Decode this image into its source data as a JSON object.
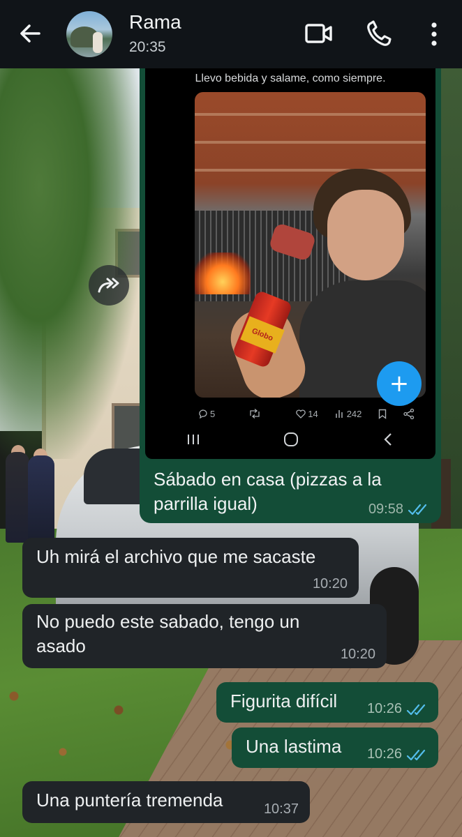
{
  "header": {
    "contact_name": "Rama",
    "last_seen": "20:35",
    "icons": [
      "back-arrow-icon",
      "video-call-icon",
      "phone-icon",
      "more-options-icon"
    ]
  },
  "image_message": {
    "tweet_text": "Llevo bebida y salame, como siempre.",
    "can_text": "Globo",
    "stats": {
      "replies": "5",
      "likes": "14",
      "views": "242"
    },
    "caption": "Sábado en casa (pizzas a la parrilla igual)",
    "time": "09:58",
    "status": "read"
  },
  "messages": [
    {
      "direction": "in",
      "text": "Uh mirá el archivo que me sacaste",
      "time": "10:20"
    },
    {
      "direction": "in",
      "text": "No puedo este sabado, tengo un asado",
      "time": "10:20"
    },
    {
      "direction": "out",
      "text": "Figurita difícil",
      "time": "10:26",
      "status": "read"
    },
    {
      "direction": "out",
      "text": "Una lastima",
      "time": "10:26",
      "status": "read"
    },
    {
      "direction": "in",
      "text": "Una puntería tremenda",
      "time": "10:37"
    }
  ],
  "colors": {
    "header_bg": "#101418",
    "outgoing_bubble": "#134d37",
    "incoming_bubble": "#202428",
    "read_ticks": "#53bdeb",
    "fab_blue": "#1d9bf0"
  }
}
